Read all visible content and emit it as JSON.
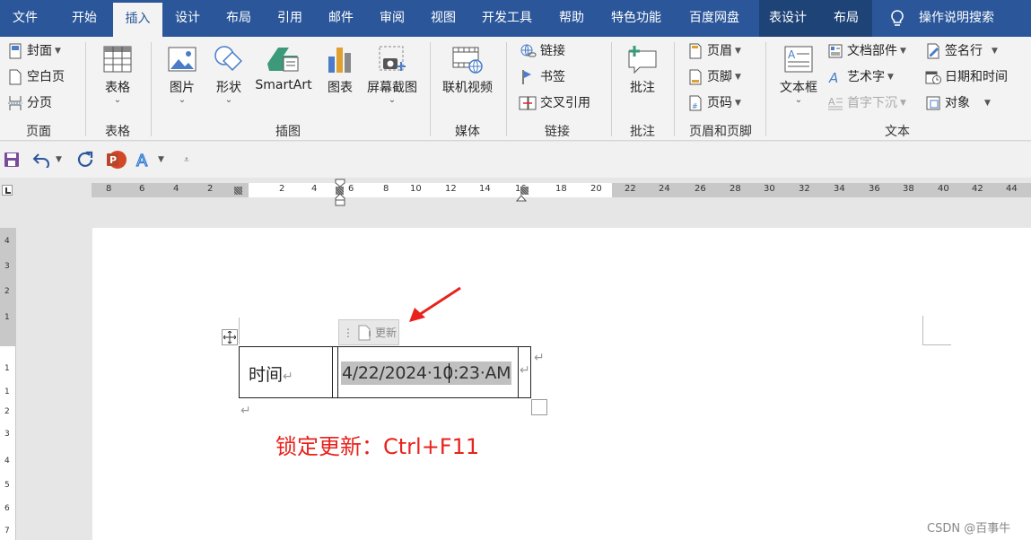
{
  "tabs": [
    {
      "label": "文件"
    },
    {
      "label": "开始"
    },
    {
      "label": "插入"
    },
    {
      "label": "设计"
    },
    {
      "label": "布局"
    },
    {
      "label": "引用"
    },
    {
      "label": "邮件"
    },
    {
      "label": "审阅"
    },
    {
      "label": "视图"
    },
    {
      "label": "开发工具"
    },
    {
      "label": "帮助"
    },
    {
      "label": "特色功能"
    },
    {
      "label": "百度网盘"
    },
    {
      "label": "表设计"
    },
    {
      "label": "布局"
    }
  ],
  "tell_me": "操作说明搜索",
  "ribbon": {
    "pages": {
      "cover": "封面",
      "blank": "空白页",
      "break": "分页",
      "group": "页面"
    },
    "tables": {
      "table": "表格",
      "group": "表格"
    },
    "illustrations": {
      "picture": "图片",
      "shapes": "形状",
      "smartart": "SmartArt",
      "chart": "图表",
      "screenshot": "屏幕截图",
      "group": "插图"
    },
    "media": {
      "online_video": "联机视频",
      "group": "媒体"
    },
    "links": {
      "link": "链接",
      "bookmark": "书签",
      "cross_ref": "交叉引用",
      "group": "链接"
    },
    "comments": {
      "comment": "批注",
      "group": "批注"
    },
    "header_footer": {
      "header": "页眉",
      "footer": "页脚",
      "page_number": "页码",
      "group": "页眉和页脚"
    },
    "text": {
      "textbox": "文本框",
      "quick_parts": "文档部件",
      "wordart": "艺术字",
      "drop_cap": "首字下沉",
      "signature": "签名行",
      "datetime": "日期和时间",
      "object": "对象",
      "group": "文本"
    }
  },
  "hruler_labels": [
    "8",
    "6",
    "4",
    "2",
    "2",
    "4",
    "6",
    "8",
    "10",
    "12",
    "14",
    "16",
    "18",
    "20",
    "22",
    "24",
    "26",
    "28",
    "30",
    "32",
    "34",
    "36",
    "38",
    "40",
    "42",
    "44"
  ],
  "vruler_labels": [
    "4",
    "3",
    "2",
    "1",
    "1",
    "1",
    "2",
    "3",
    "4",
    "5",
    "6",
    "7"
  ],
  "document": {
    "cell_label": "时间",
    "field_value": "4/22/2024·10:23·AM",
    "update_tag": "更新",
    "annotation": "锁定更新：Ctrl+F11",
    "para_mark": "↵"
  },
  "watermark": "CSDN @百事牛",
  "colors": {
    "ribbon_blue": "#2b579a",
    "annotation_red": "#e8221c",
    "field_shade": "#c0c0c0"
  }
}
